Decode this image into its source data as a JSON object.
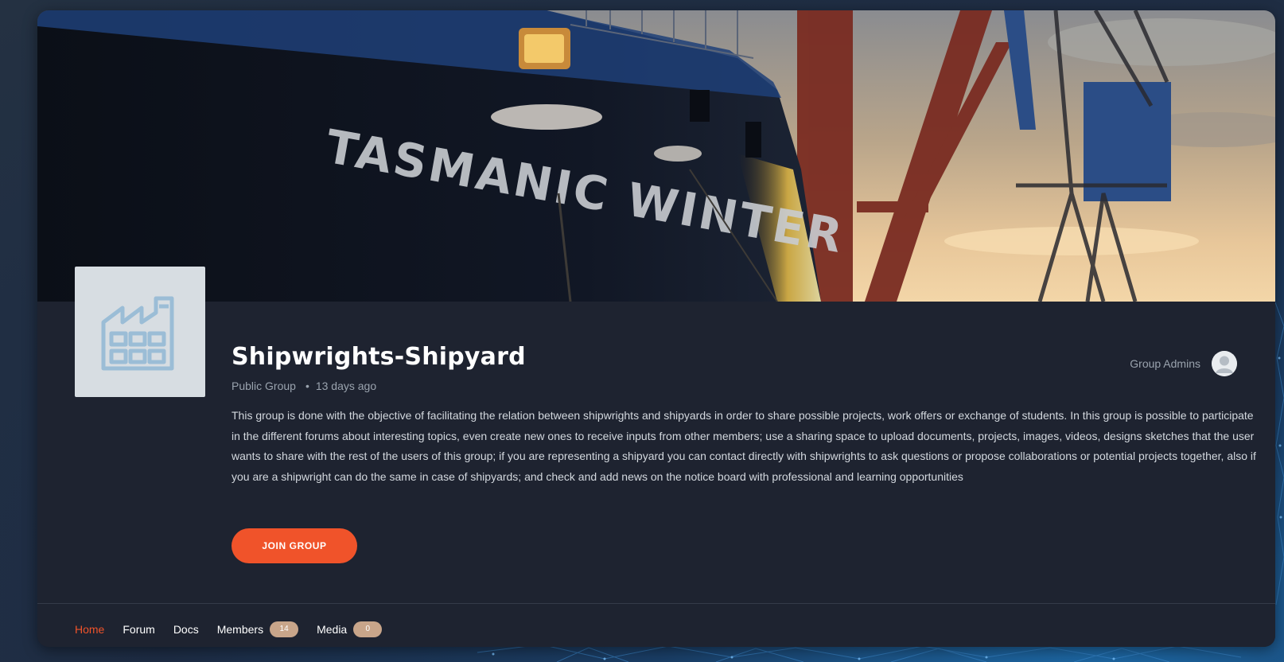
{
  "group": {
    "name": "Shipwrights-Shipyard",
    "type": "Public Group",
    "separator": "•",
    "activity": "13 days ago",
    "description": "This group is done with the objective of facilitating the relation between shipwrights and shipyards in order to share possible projects, work offers or exchange of students. In this group is possible to participate in the different forums about interesting topics, even create new ones to receive inputs from other members; use a sharing space to upload documents, projects, images, videos, designs sketches that the user wants to share with the rest of the users of this group; if you are representing a shipyard you can contact directly with shipwrights to ask questions or propose collaborations or potential projects together, also if you are a shipwright can do the same in case of shipyards; and check and add news on the notice board with professional and learning opportunities",
    "join_label": "JOIN GROUP",
    "admins_label": "Group Admins",
    "avatar_icon": "factory-icon",
    "cover_ship_text": "TASMANIC WINTER"
  },
  "nav": {
    "home": "Home",
    "forum": "Forum",
    "docs": "Docs",
    "members": "Members",
    "members_count": "14",
    "media": "Media",
    "media_count": "0"
  },
  "colors": {
    "accent": "#f0532a",
    "card_bg": "#1e2330",
    "badge": "#c8a58a"
  }
}
